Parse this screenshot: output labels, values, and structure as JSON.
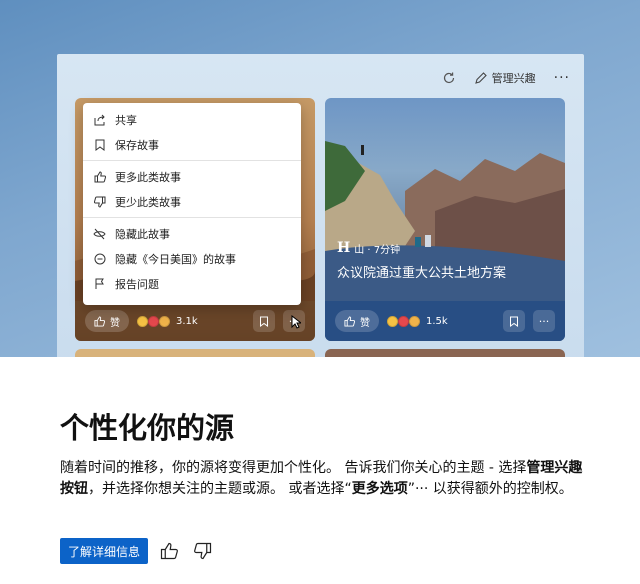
{
  "toolbar": {
    "refresh_icon": "refresh-icon",
    "manage_label": "管理兴趣",
    "more_icon": "more-icon"
  },
  "menu": {
    "items": [
      {
        "label": "共享",
        "icon": "share-icon"
      },
      {
        "label": "保存故事",
        "icon": "bookmark-icon"
      },
      {
        "label": "更多此类故事",
        "icon": "thumbs-up-icon"
      },
      {
        "label": "更少此类故事",
        "icon": "thumbs-down-icon"
      },
      {
        "label": "隐藏此故事",
        "icon": "eye-slash-icon"
      },
      {
        "label": "隐藏《今日美国》的故事",
        "icon": "minus-circle-icon"
      },
      {
        "label": "报告问题",
        "icon": "flag-icon"
      }
    ]
  },
  "cards": [
    {
      "like_label": "赞",
      "count": "3.1k"
    },
    {
      "source_initial": "H",
      "meta": "山 · 7分钟",
      "title": "众议院通过重大公共土地方案",
      "like_label": "赞",
      "count": "1.5k"
    }
  ],
  "info": {
    "heading": "个性化你的源",
    "desc_1": "随着时间的推移，你的源将变得更加个性化。 告诉我们你关心的主题 - 选择",
    "desc_bold_1": "管理兴趣按钮",
    "desc_2": "，并选择你想关注的主题或源。 或者选择“",
    "desc_bold_2": "更多选项",
    "desc_3": "”··· 以获得额外的控制权。",
    "learn_more": "了解详细信息"
  },
  "colors": {
    "accent": "#0c63c8",
    "card_right_footer": "#284e84"
  }
}
